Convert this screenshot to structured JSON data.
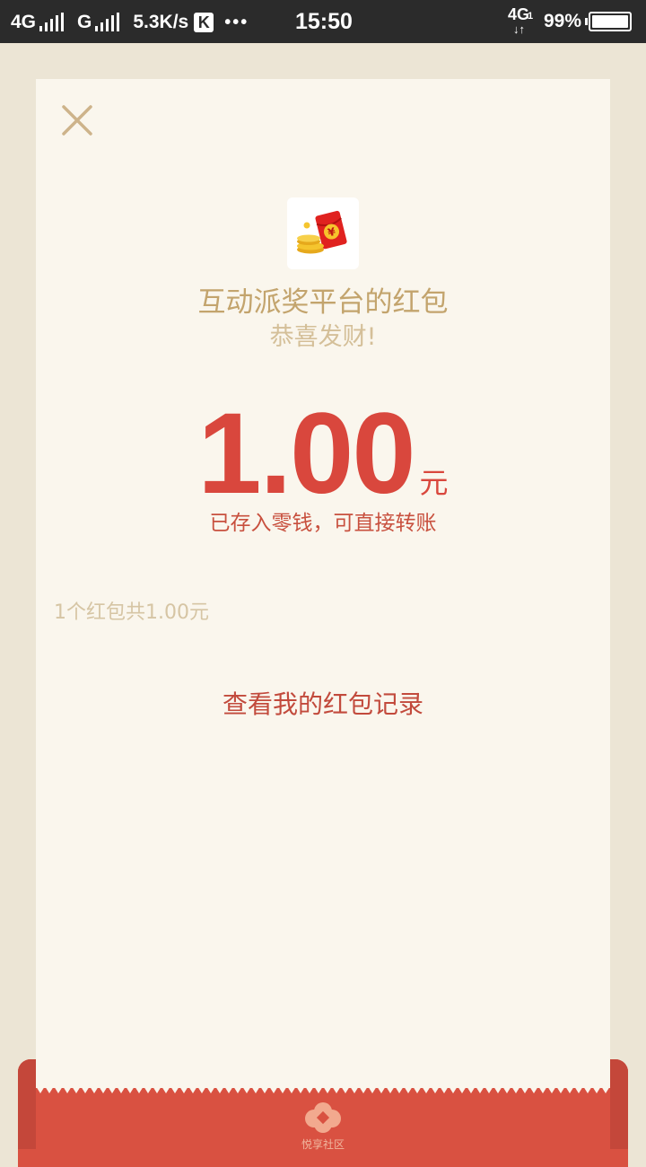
{
  "status_bar": {
    "net1": "4G",
    "net2": "G",
    "speed": "5.3K/s",
    "k_badge": "K",
    "dots": "•••",
    "time": "15:50",
    "lte_label": "4G",
    "lte_sub": "1",
    "lte_arrows": "↓↑",
    "battery_text": "99%",
    "battery_level": 0.99
  },
  "packet": {
    "sender": "互动派奖平台的红包",
    "greeting": "恭喜发财!",
    "amount": "1.00",
    "unit": "元",
    "note": "已存入零钱，可直接转账",
    "summary": "1个红包共1.00元",
    "records_link": "查看我的红包记录"
  },
  "footer": {
    "brand": "悦享社区"
  },
  "colors": {
    "card_bg": "#faf6ed",
    "page_bg": "#ece5d5",
    "gold": "#c3a46d",
    "red": "#d9473d"
  },
  "icons": {
    "close": "close-icon",
    "logo": "red-envelope-coins-icon",
    "footer": "flower-icon"
  }
}
